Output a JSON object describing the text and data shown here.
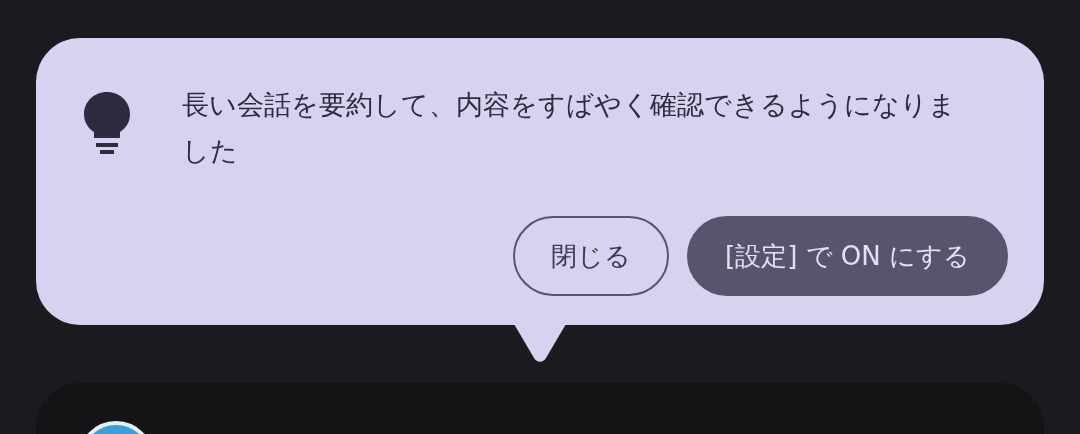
{
  "tip": {
    "message": "長い会話を要約して、内容をすばやく確認できるようになりました",
    "buttons": [
      {
        "label": "閉じる",
        "kind": "outlined"
      },
      {
        "label": "[設定] で ON にする",
        "kind": "filled"
      }
    ]
  }
}
